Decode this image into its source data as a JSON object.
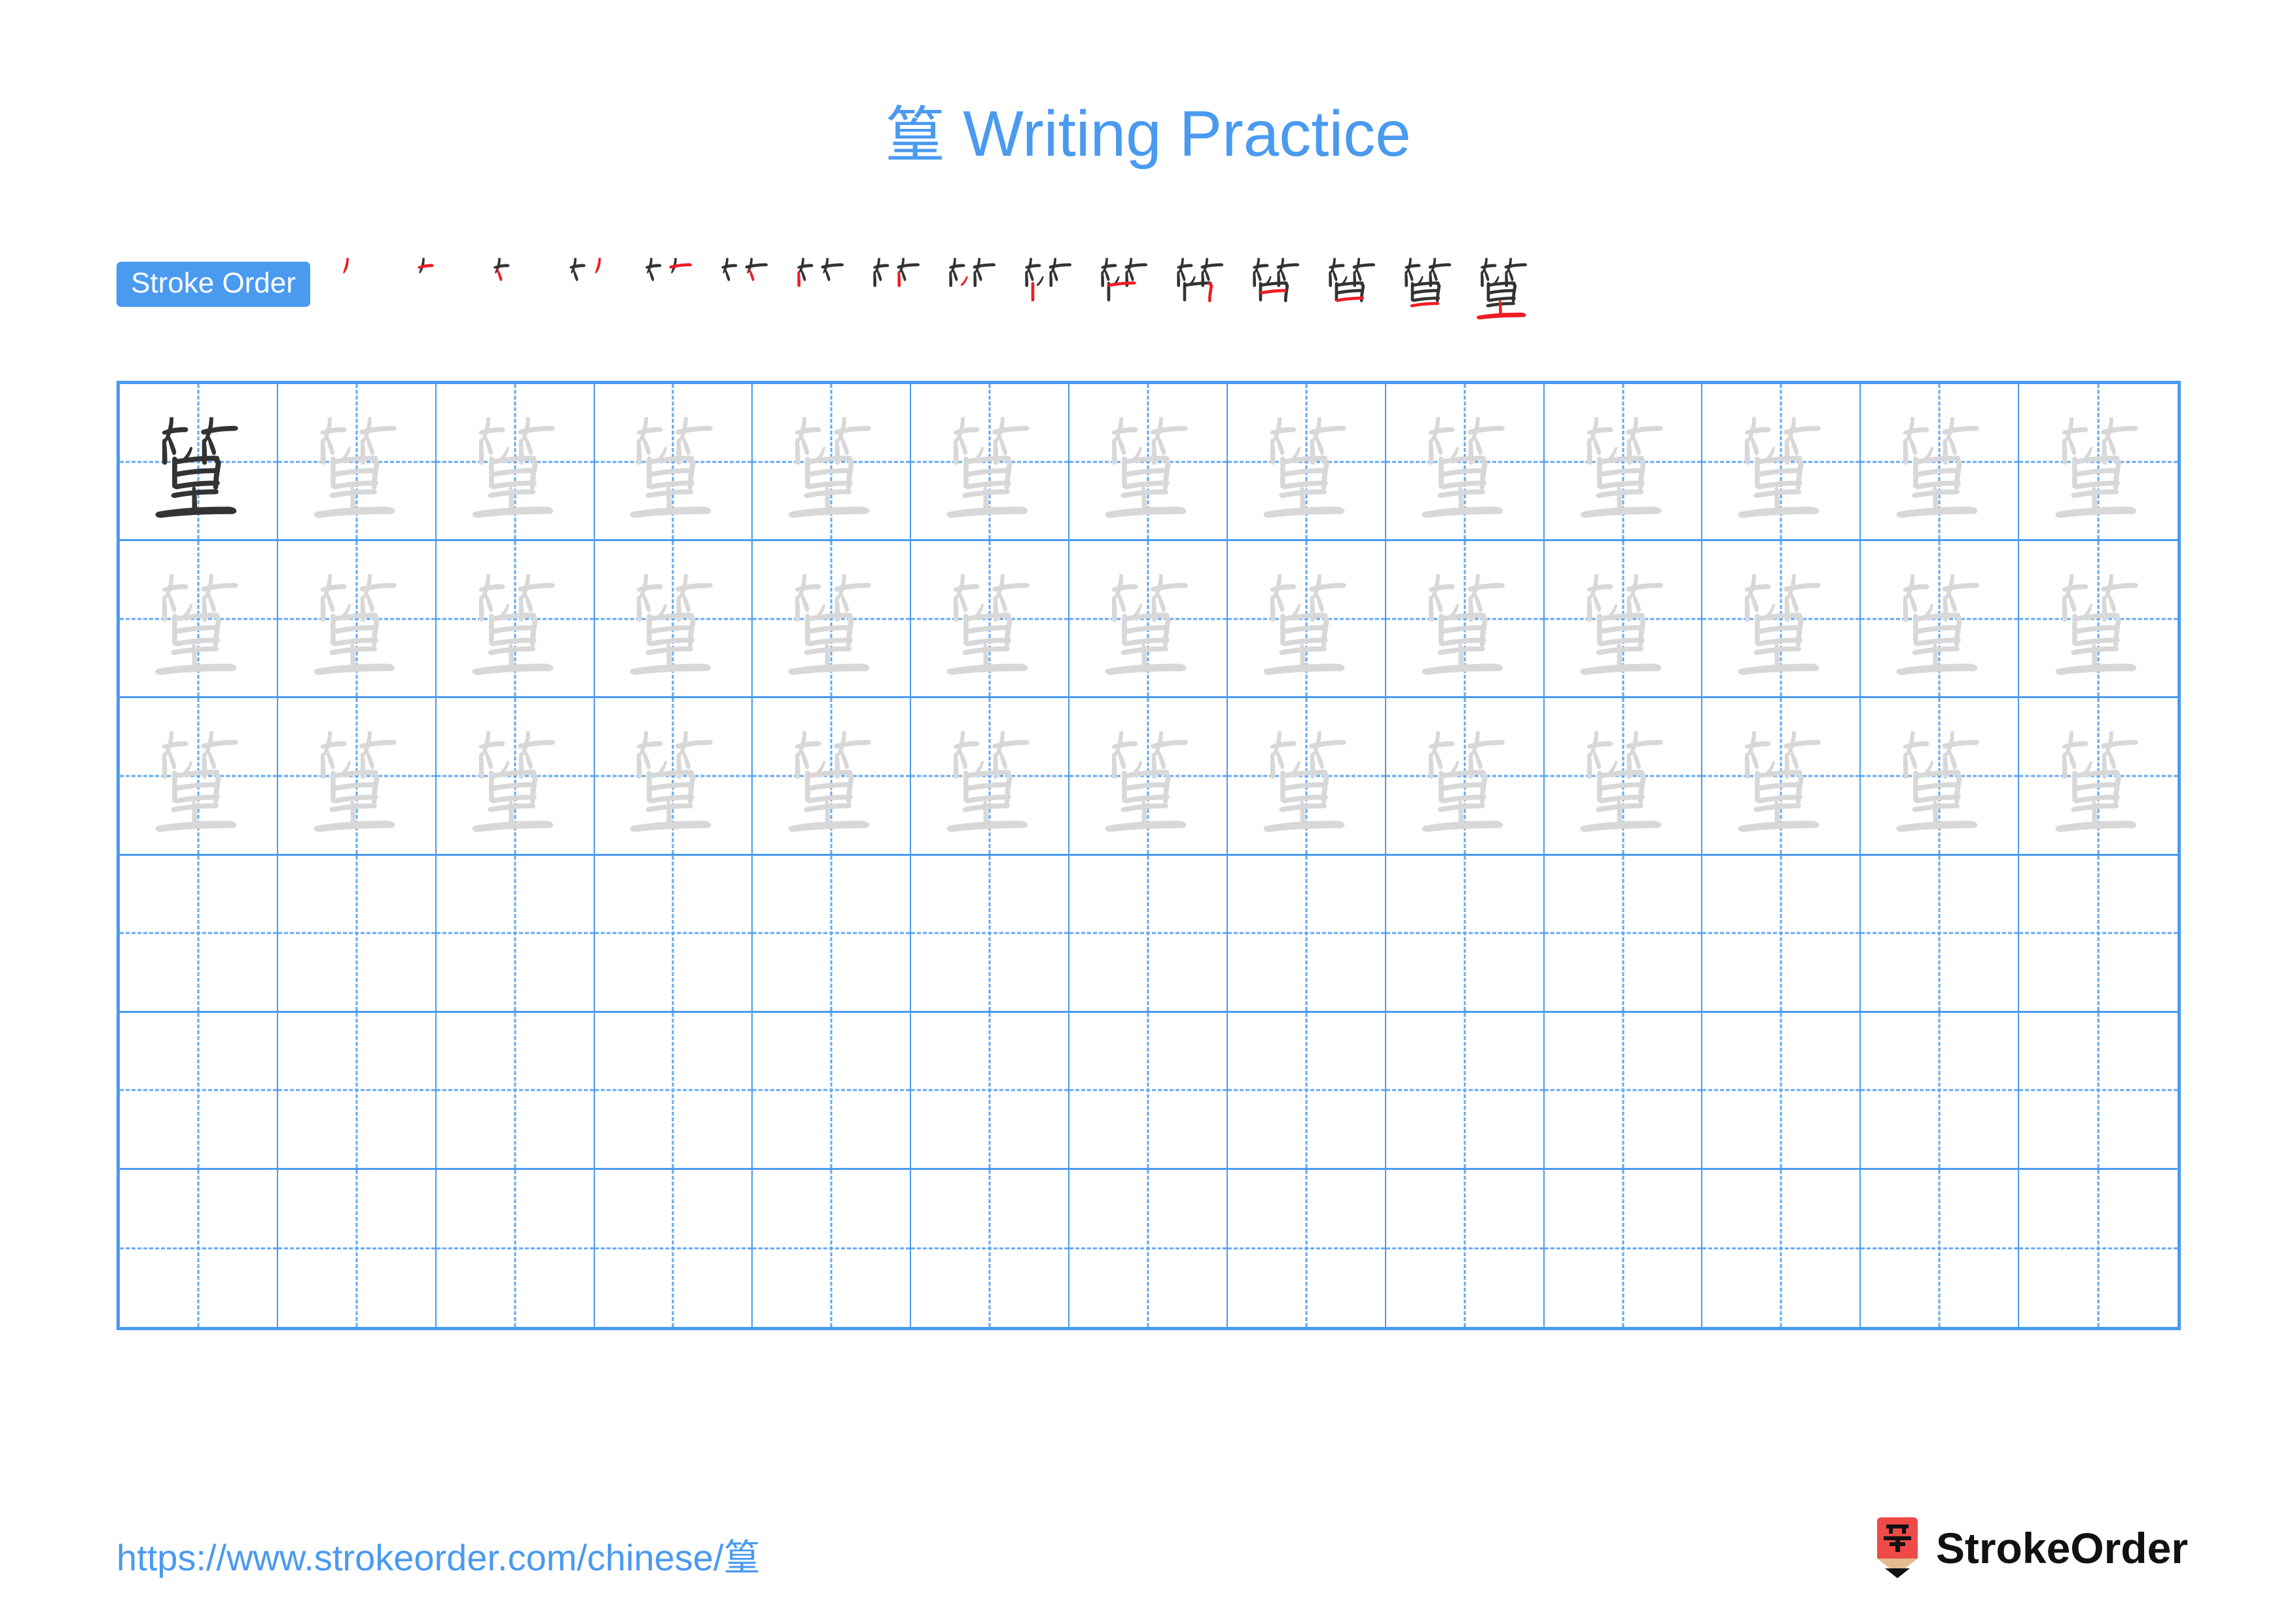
{
  "meta": {
    "character": "篁",
    "stroke_count": 15,
    "accent_color": "#4a9af0",
    "grid_line_color": "#4a9af0",
    "guide_line_color": "#63a8f2",
    "model_char_color": "#333333",
    "trace_char_color": "#d8d8d8",
    "new_stroke_color": "#ee1c25",
    "logo_red": "#ef4a48",
    "logo_wood": "#e3bb90"
  },
  "title": {
    "character": "篁",
    "text": " Writing Practice",
    "full": "篁 Writing Practice"
  },
  "stroke_order": {
    "badge_label": "Stroke Order",
    "steps": [
      {
        "index": 1,
        "label": "stroke-1"
      },
      {
        "index": 2,
        "label": "stroke-2"
      },
      {
        "index": 3,
        "label": "stroke-3"
      },
      {
        "index": 4,
        "label": "stroke-4"
      },
      {
        "index": 5,
        "label": "stroke-5"
      },
      {
        "index": 6,
        "label": "stroke-6"
      },
      {
        "index": 7,
        "label": "stroke-7"
      },
      {
        "index": 8,
        "label": "stroke-8"
      },
      {
        "index": 9,
        "label": "stroke-9"
      },
      {
        "index": 10,
        "label": "stroke-10"
      },
      {
        "index": 11,
        "label": "stroke-11"
      },
      {
        "index": 12,
        "label": "stroke-12"
      },
      {
        "index": 13,
        "label": "stroke-13"
      },
      {
        "index": 14,
        "label": "stroke-14"
      },
      {
        "index": 15,
        "label": "stroke-15"
      },
      {
        "index": 16,
        "label": "stroke-16"
      }
    ]
  },
  "practice_grid": {
    "columns": 13,
    "rows": 6,
    "character": "篁",
    "rows_data": [
      {
        "row": 1,
        "cells": [
          "model",
          "trace",
          "trace",
          "trace",
          "trace",
          "trace",
          "trace",
          "trace",
          "trace",
          "trace",
          "trace",
          "trace",
          "trace"
        ]
      },
      {
        "row": 2,
        "cells": [
          "trace",
          "trace",
          "trace",
          "trace",
          "trace",
          "trace",
          "trace",
          "trace",
          "trace",
          "trace",
          "trace",
          "trace",
          "trace"
        ]
      },
      {
        "row": 3,
        "cells": [
          "trace",
          "trace",
          "trace",
          "trace",
          "trace",
          "trace",
          "trace",
          "trace",
          "trace",
          "trace",
          "trace",
          "trace",
          "trace"
        ]
      },
      {
        "row": 4,
        "cells": [
          "empty",
          "empty",
          "empty",
          "empty",
          "empty",
          "empty",
          "empty",
          "empty",
          "empty",
          "empty",
          "empty",
          "empty",
          "empty"
        ]
      },
      {
        "row": 5,
        "cells": [
          "empty",
          "empty",
          "empty",
          "empty",
          "empty",
          "empty",
          "empty",
          "empty",
          "empty",
          "empty",
          "empty",
          "empty",
          "empty"
        ]
      },
      {
        "row": 6,
        "cells": [
          "empty",
          "empty",
          "empty",
          "empty",
          "empty",
          "empty",
          "empty",
          "empty",
          "empty",
          "empty",
          "empty",
          "empty",
          "empty"
        ]
      }
    ]
  },
  "footer": {
    "url": "https://www.strokeorder.com/chinese/篁",
    "url_base": "https://www.strokeorder.com/chinese/",
    "url_char": "篁",
    "brand_name": "StrokeOrder",
    "brand_mark_char": "字"
  }
}
